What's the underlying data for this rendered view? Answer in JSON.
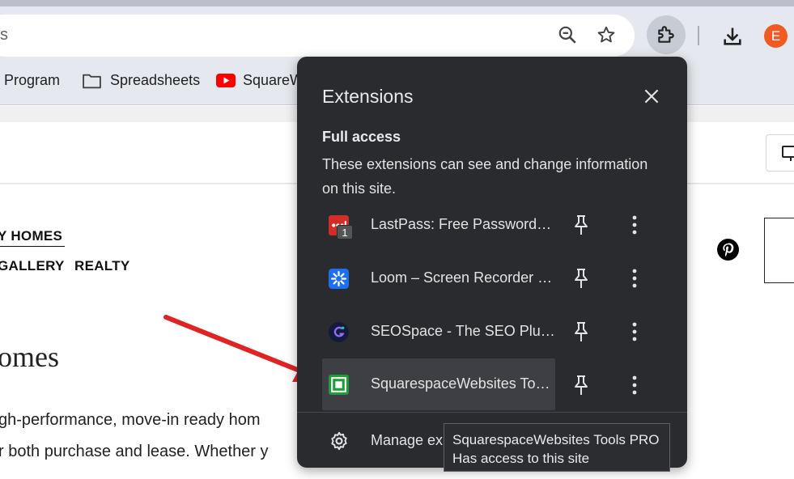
{
  "browser": {
    "omnibox_text": "s",
    "avatar_initial": "E",
    "accent": "#f25a24",
    "icons": [
      "zoom-icon",
      "star-icon",
      "extensions-puzzle-icon",
      "download-icon"
    ]
  },
  "bookmarks": [
    {
      "label": "Program",
      "icon": "none"
    },
    {
      "label": "Spreadsheets",
      "icon": "folder-icon"
    },
    {
      "label": "SquareW",
      "icon": "youtube-icon"
    }
  ],
  "page": {
    "nav": [
      "Y HOMES",
      "GALLERY",
      "REALTY"
    ],
    "heading": "omes",
    "body_lines": [
      "gh-performance, move-in ready hom",
      "r both purchase and lease. Whether y"
    ]
  },
  "extensions_popup": {
    "title": "Extensions",
    "section_title": "Full access",
    "section_desc": "These extensions can see and change information on this site.",
    "items": [
      {
        "name": "LastPass: Free Password M...",
        "icon": "lastpass-icon",
        "badge": "1"
      },
      {
        "name": "Loom – Screen Recorder &...",
        "icon": "loom-icon"
      },
      {
        "name": "SEOSpace - The SEO Plugi...",
        "icon": "seospace-icon"
      },
      {
        "name": "SquarespaceWebsites Tool...",
        "icon": "squarespacewebsites-icon"
      }
    ],
    "manage_label": "Manage ex",
    "colors": {
      "popup_bg": "#2a2b2f",
      "active_row": "#3e3f44"
    }
  },
  "tooltip": {
    "line1": "SquarespaceWebsites Tools PRO",
    "line2": "Has access to this site"
  },
  "annotation": {
    "arrow_color": "#e02424"
  }
}
